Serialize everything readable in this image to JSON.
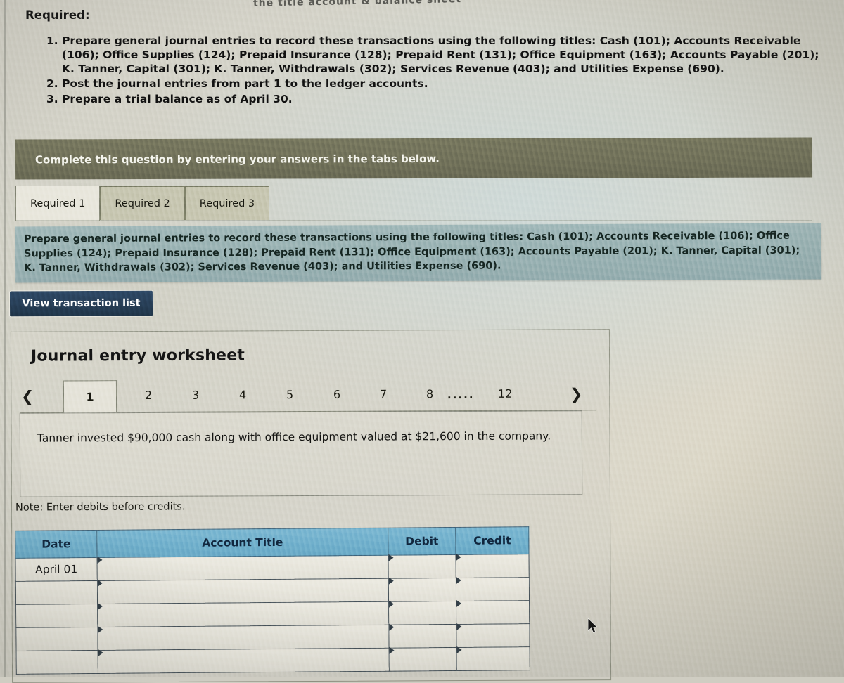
{
  "clipped_top_text": "the title account & balance sheet",
  "required": {
    "heading": "Required:",
    "items": [
      "1. Prepare general journal entries to record these transactions using the following titles: Cash (101); Accounts Receivable (106); Office Supplies (124); Prepaid Insurance (128); Prepaid Rent (131); Office Equipment (163); Accounts Payable (201); K. Tanner, Capital (301); K. Tanner, Withdrawals (302); Services Revenue (403); and Utilities Expense (690).",
      "2. Post the journal entries from part 1 to the ledger accounts.",
      "3. Prepare a trial balance as of April 30."
    ]
  },
  "banner": {
    "text": "Complete this question by entering your answers in the tabs below."
  },
  "tabs": [
    {
      "label": "Required 1",
      "active": true
    },
    {
      "label": "Required 2",
      "active": false
    },
    {
      "label": "Required 3",
      "active": false
    }
  ],
  "description": {
    "text": "Prepare general journal entries to record these transactions using the following titles: Cash (101); Accounts Receivable (106); Office Supplies (124); Prepaid Insurance (128); Prepaid Rent (131); Office Equipment (163); Accounts Payable (201); K. Tanner, Capital (301); K. Tanner, Withdrawals (302); Services Revenue (403); and Utilities Expense (690)."
  },
  "view_transaction_button": {
    "label": "View transaction list"
  },
  "worksheet": {
    "title": "Journal entry worksheet",
    "pagination": {
      "prev_icon": "chevron-left",
      "next_icon": "chevron-right",
      "pages": [
        "1",
        "2",
        "3",
        "4",
        "5",
        "6",
        "7",
        "8"
      ],
      "ellipsis": ".....",
      "last_page": "12",
      "active_page": "1"
    },
    "transaction_text": "Tanner invested $90,000 cash along with office equipment valued at $21,600 in the company.",
    "note": "Note: Enter debits before credits.",
    "table": {
      "columns": [
        "Date",
        "Account Title",
        "Debit",
        "Credit"
      ],
      "rows": [
        {
          "date": "April 01",
          "account": "",
          "debit": "",
          "credit": ""
        },
        {
          "date": "",
          "account": "",
          "debit": "",
          "credit": ""
        },
        {
          "date": "",
          "account": "",
          "debit": "",
          "credit": ""
        },
        {
          "date": "",
          "account": "",
          "debit": "",
          "credit": ""
        },
        {
          "date": "",
          "account": "",
          "debit": "",
          "credit": ""
        }
      ]
    }
  },
  "colors": {
    "banner_olive": "#6a6a54",
    "tab_active": "#e7e5da",
    "tab_inactive": "#c3c2ab",
    "description_panel": "#93adae",
    "button_navy": "#24394f",
    "table_header_blue": "#6aaac8",
    "page_background": "#d1cfc4"
  },
  "cursor": {
    "icon": "mouse-pointer"
  }
}
